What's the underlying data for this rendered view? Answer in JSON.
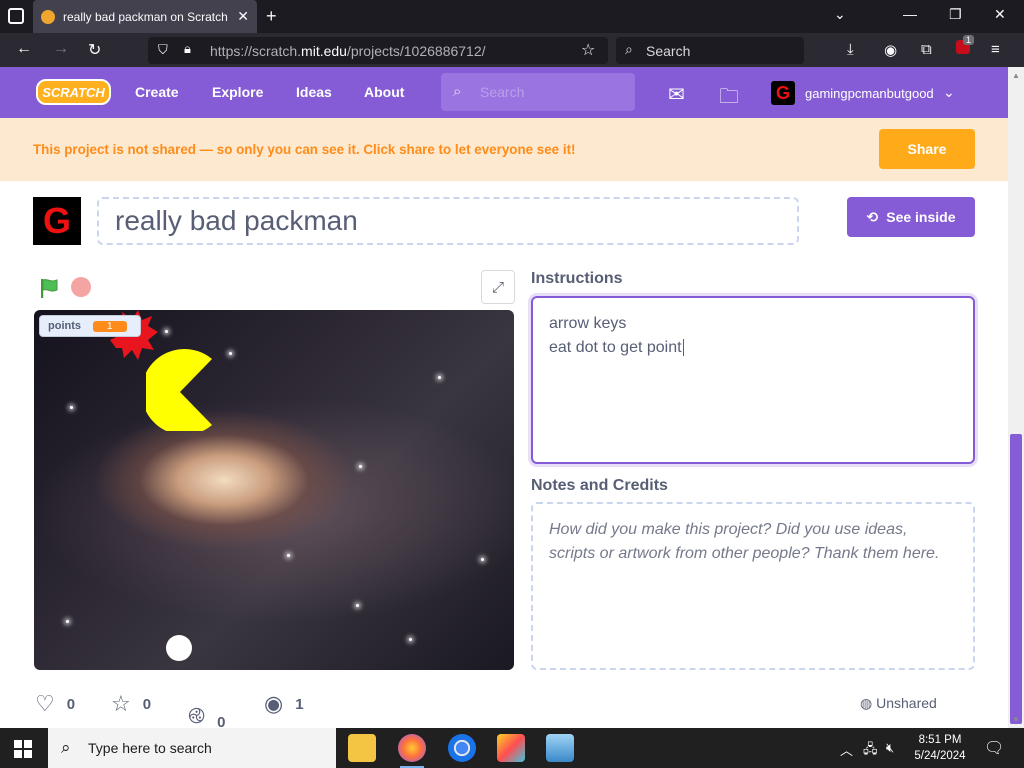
{
  "browser": {
    "tab_title": "really bad packman on Scratch",
    "url_domain_prefix": "https://scratch.",
    "url_domain": "mit.edu",
    "url_path": "/projects/1026886712/",
    "search_placeholder": "Search",
    "extension_badge": "1"
  },
  "scratch_nav": {
    "logo": "SCRATCH",
    "links": [
      "Create",
      "Explore",
      "Ideas",
      "About"
    ],
    "search_placeholder": "Search",
    "username": "gamingpcmanbutgood"
  },
  "banner": {
    "text": "This project is not shared — so only you can see it. Click share to let everyone see it!",
    "share_label": "Share"
  },
  "project": {
    "title": "really bad packman",
    "see_inside_label": "See inside",
    "instructions_heading": "Instructions",
    "instructions_lines": [
      "arrow keys",
      "eat dot to get point"
    ],
    "notes_heading": "Notes and Credits",
    "notes_placeholder": "How did you make this project? Did you use ideas, scripts or artwork from other people? Thank them here."
  },
  "stage": {
    "variable_name": "points",
    "variable_value": "1"
  },
  "stats": {
    "loves": "0",
    "favorites": "0",
    "remixes": "0",
    "views": "1",
    "share_status": "Unshared"
  },
  "taskbar": {
    "search_placeholder": "Type here to search",
    "time": "8:51 PM",
    "date": "5/24/2024"
  },
  "colors": {
    "scratch_purple": "#855cd6",
    "share_orange": "#ffab19",
    "banner_bg": "#fce9cf",
    "pacman_yellow": "#ffff00"
  }
}
